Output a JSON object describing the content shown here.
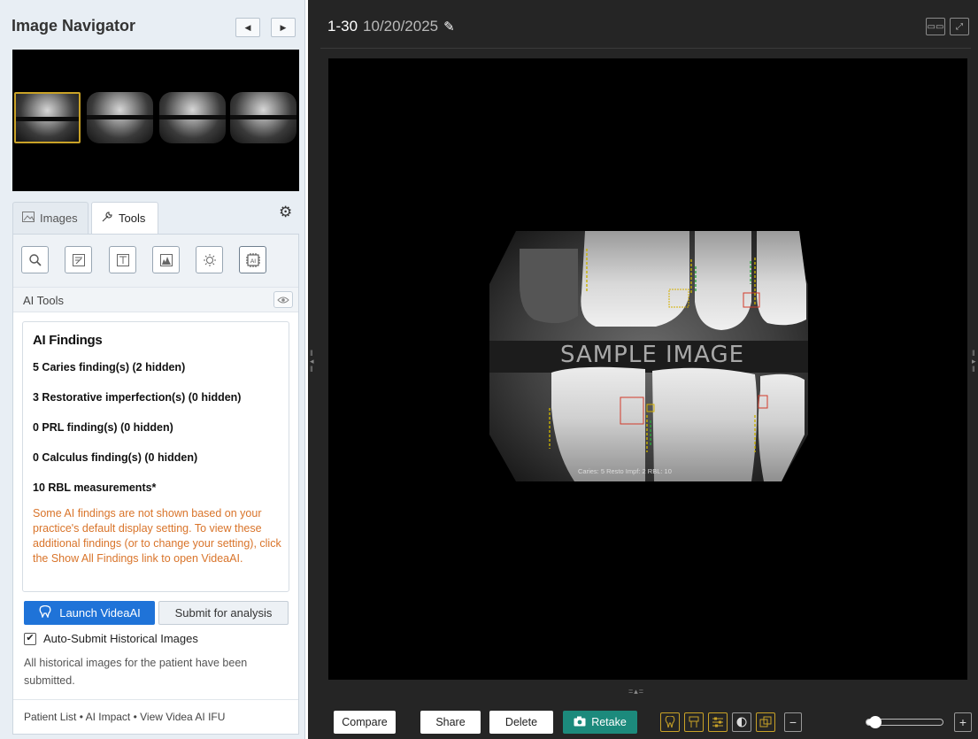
{
  "navigator": {
    "title": "Image Navigator",
    "prev_icon": "triangle-left",
    "next_icon": "triangle-right"
  },
  "tabs": {
    "images_label": "Images",
    "tools_label": "Tools",
    "active": "Tools"
  },
  "tool_icons": [
    "zoom-tool",
    "annotate-tool",
    "text-tool",
    "histogram-tool",
    "brightness-tool",
    "ai-tool"
  ],
  "ai_tools": {
    "label": "AI Tools",
    "findings_title": "AI Findings",
    "lines": [
      "5 Caries finding(s) (2 hidden)",
      "3 Restorative imperfection(s) (0 hidden)",
      "0 PRL finding(s) (0 hidden)",
      "0 Calculus finding(s) (0 hidden)",
      "10 RBL measurements*"
    ],
    "note": "Some AI findings are not shown based on your practice's default display setting. To view these additional findings (or to change your setting), click the Show All Findings link to open VideaAI.",
    "launch_label": "Launch VideaAI",
    "submit_label": "Submit for analysis",
    "auto_submit_label": "Auto-Submit Historical Images",
    "auto_submit_checked": true,
    "history_note": "All historical images for the patient have been submitted.",
    "footer": "Patient List • AI Impact • View Videa AI IFU"
  },
  "viewer": {
    "title_num": "1-30",
    "title_date": "10/20/2025",
    "watermark": "SAMPLE IMAGE",
    "caption": "Caries: 5 Resto Impf: 2 RBL: 10",
    "buttons": {
      "compare": "Compare",
      "share": "Share",
      "delete": "Delete",
      "retake": "Retake"
    },
    "zoom_minus": "−",
    "zoom_plus": "+",
    "zoom_level": 0.12
  },
  "colors": {
    "accent_blue": "#1f73d8",
    "retake_teal": "#1c8a7c",
    "note_orange": "#d9742a",
    "selection_gold": "#c9a227"
  }
}
